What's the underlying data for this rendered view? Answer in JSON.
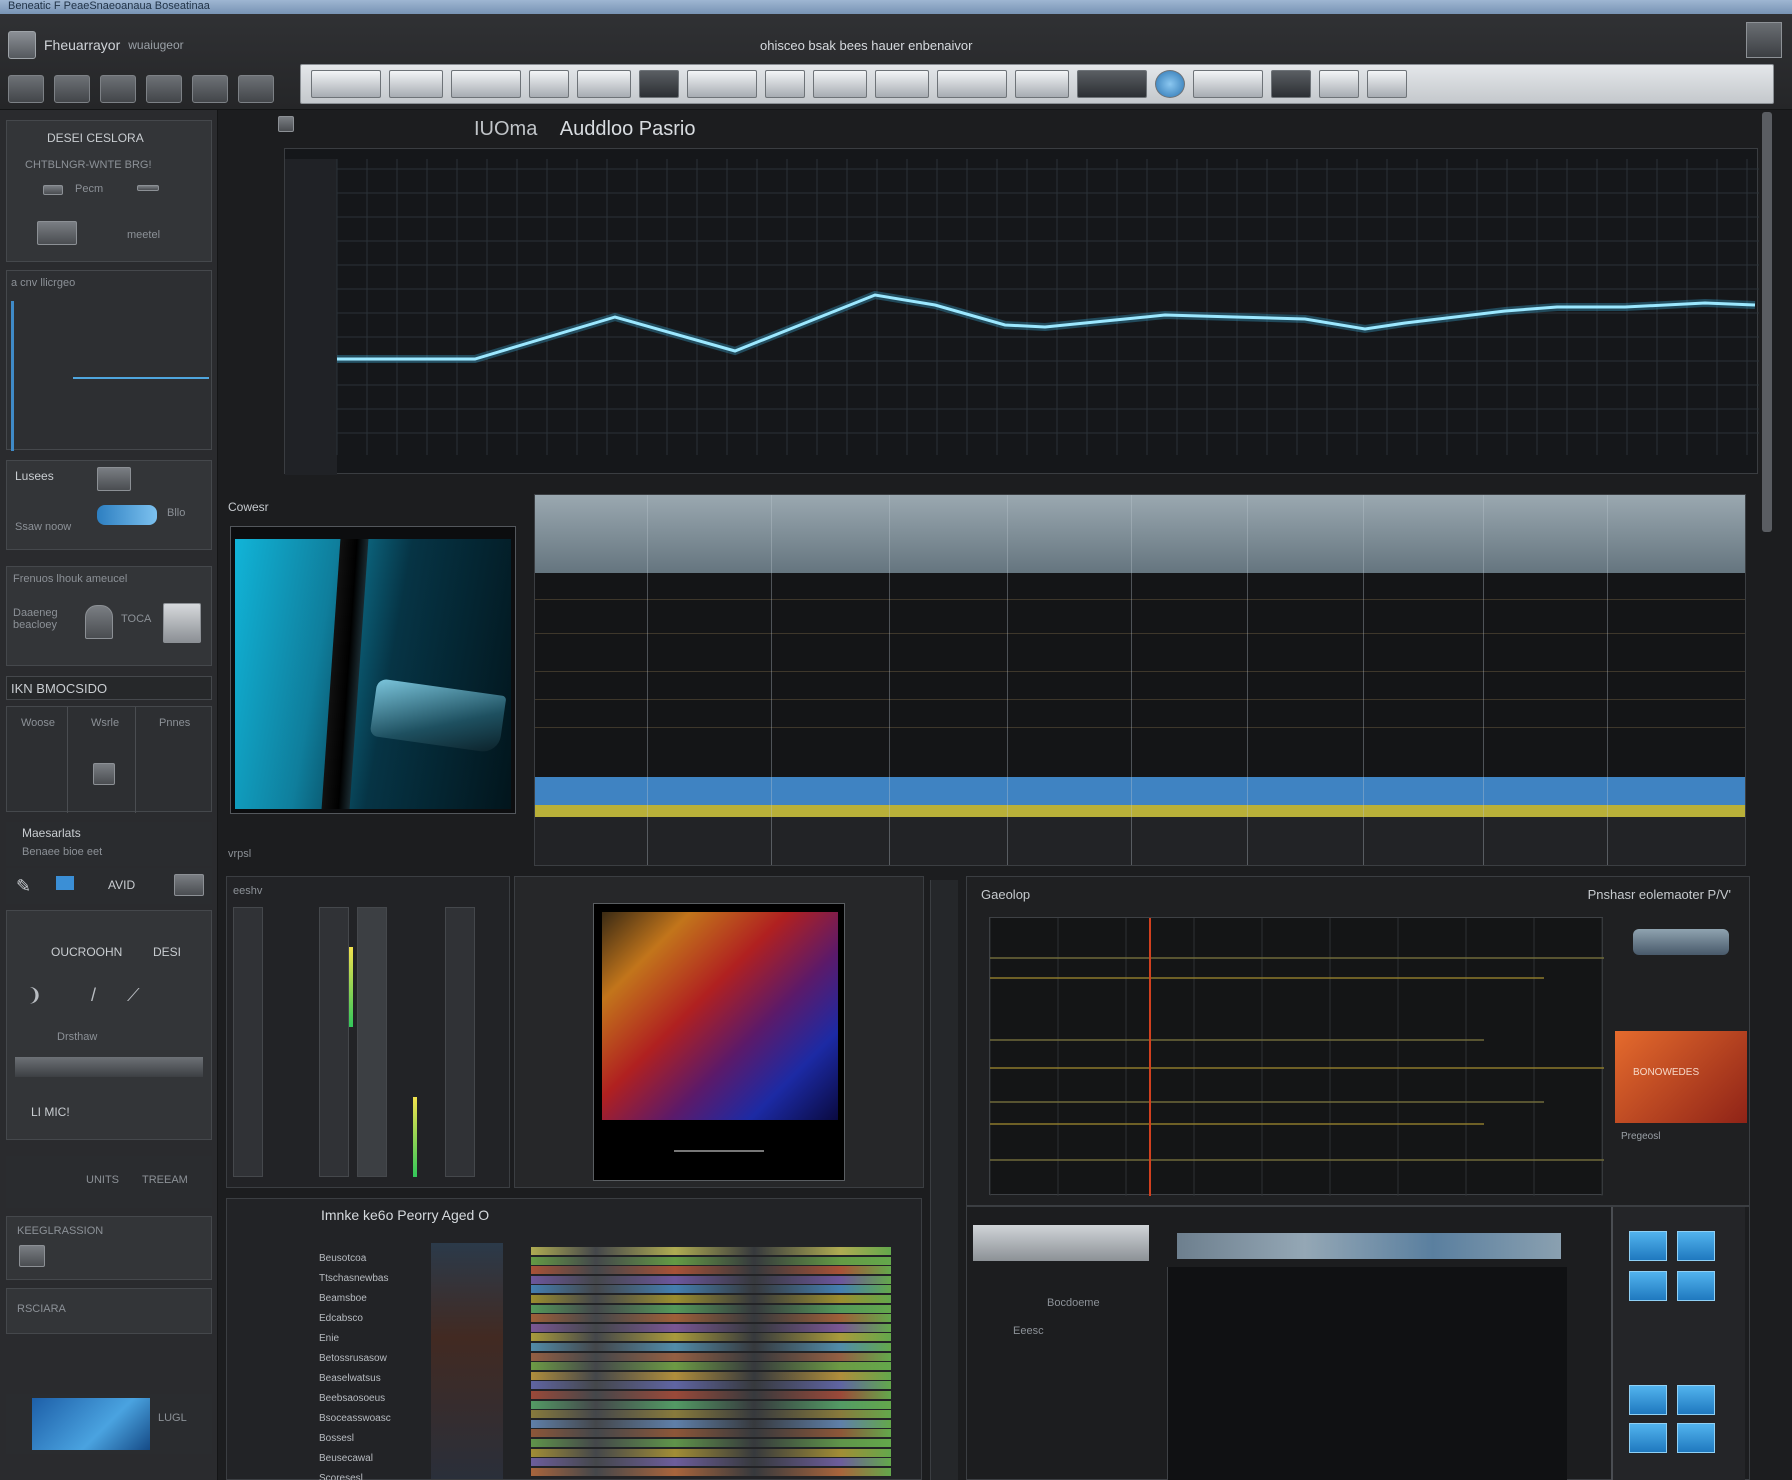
{
  "window": {
    "title_partial": "Beneatic F PeaeSnaeoanaua Boseatinaa",
    "center_title": "ohisceo bsak bees hauer enbenaivor",
    "app_name": "Fheuarrayor",
    "app_sub": "wuaiugeor"
  },
  "sidebar": {
    "panel1_title": "DESEI CESLORA",
    "panel1_sub": "CHTBLNGR-WNTE BRG!",
    "panel1_row1": "Pecm",
    "panel1_row2": "meetel",
    "panel2_title": "a cnv llicrgeo",
    "panel3_title": "Lusees",
    "panel3_sub": "Ssaw noow",
    "panel3_btn": "Bllo",
    "panel4_title": "Frenuos lhouk ameucel",
    "panel4_text": "Daaeneg beacloey",
    "panel4_btn": "TOCA",
    "panel5_title": "IKN BMOCSIDO",
    "panel5_cols": [
      "Woose",
      "Wsrle",
      "Pnnes"
    ],
    "panel6_title": "Maesarlats",
    "panel6_sub": "Benaee bioe eet",
    "panel6_label": "AVID",
    "panel7_title": "OUCROOHN",
    "panel7_side": "DESI",
    "panel8_title": "Drsthaw",
    "panel9_title": "LI MIC!",
    "panel10_label1": "UNITS",
    "panel10_label2": "TREEAM",
    "panel11_title": "KEEGLRASSION",
    "panel12_title": "RSCIARA",
    "footer_label": "LUGL"
  },
  "graph": {
    "prefix": "IUOma",
    "title": "Auddloo Pasrio",
    "line_color": "#9ce8ff"
  },
  "camera": {
    "label": "Cowesr",
    "sub": "vrpsl"
  },
  "mixer": {
    "label": "eeshv"
  },
  "scope": {
    "title": "Gaeolop",
    "right_title": "Pnshasr eolemaoter P/V'",
    "side_caption": "Pregeosl",
    "side_image_text": "BONOWEDES"
  },
  "list": {
    "title": "Imnke ke6o Peorry Aged O",
    "names": [
      "Beusotcoa",
      "Ttschasnewbas",
      "Beamsboe",
      "Edcabsco",
      "Enie",
      "Betossrusasow",
      "Beaselwatsus",
      "Beebsaosoeus",
      "Bsoceasswoasc",
      "Bossesl",
      "Beusecawal",
      "Scoresesl"
    ]
  },
  "clips": {
    "caption1": "Bocdoeme",
    "caption2": "Eeesc"
  }
}
